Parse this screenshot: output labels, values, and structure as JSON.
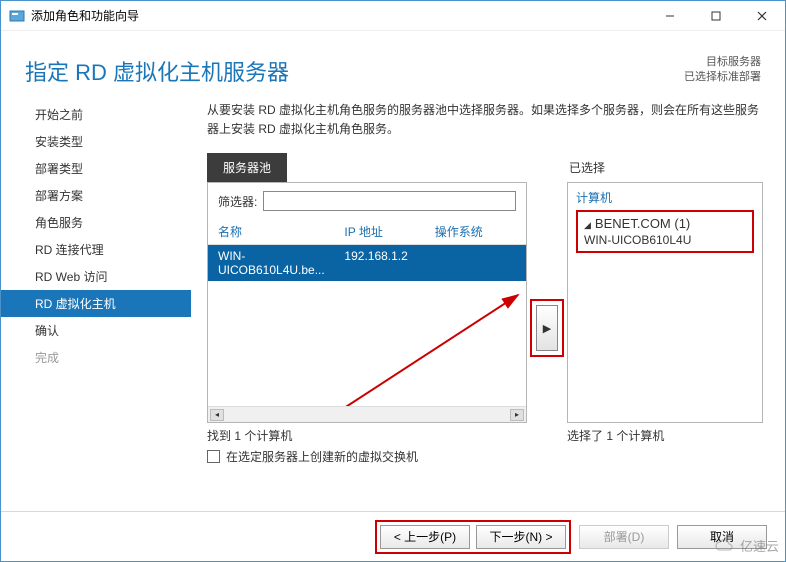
{
  "titlebar": {
    "text": "添加角色和功能向导"
  },
  "header": {
    "title": "指定 RD 虚拟化主机服务器",
    "status1": "目标服务器",
    "status2": "已选择标准部署"
  },
  "sidebar": {
    "items": [
      {
        "label": "开始之前"
      },
      {
        "label": "安装类型"
      },
      {
        "label": "部署类型"
      },
      {
        "label": "部署方案"
      },
      {
        "label": "角色服务"
      },
      {
        "label": "RD 连接代理"
      },
      {
        "label": "RD Web 访问"
      },
      {
        "label": "RD 虚拟化主机",
        "active": true
      },
      {
        "label": "确认"
      },
      {
        "label": "完成",
        "disabled": true
      }
    ]
  },
  "main": {
    "instruction": "从要安装 RD 虚拟化主机角色服务的服务器池中选择服务器。如果选择多个服务器，则会在所有这些服务器上安装 RD 虚拟化主机角色服务。",
    "pool_tab": "服务器池",
    "filter_label": "筛选器:",
    "filter_value": "",
    "cols": {
      "name": "名称",
      "ip": "IP 地址",
      "os": "操作系统"
    },
    "row": {
      "name": "WIN-UICOB610L4U.be...",
      "ip": "192.168.1.2",
      "os": ""
    },
    "found_text": "找到 1 个计算机",
    "chk_label": "在选定服务器上创建新的虚拟交换机",
    "selected_header": "已选择",
    "selected_link": "计算机",
    "domain": "BENET.COM (1)",
    "server": "WIN-UICOB610L4U",
    "selected_count": "选择了 1 个计算机",
    "transfer_glyph": "▶"
  },
  "footer": {
    "prev": "< 上一步(P)",
    "next": "下一步(N) >",
    "deploy": "部署(D)",
    "cancel": "取消"
  },
  "watermark": "亿速云"
}
